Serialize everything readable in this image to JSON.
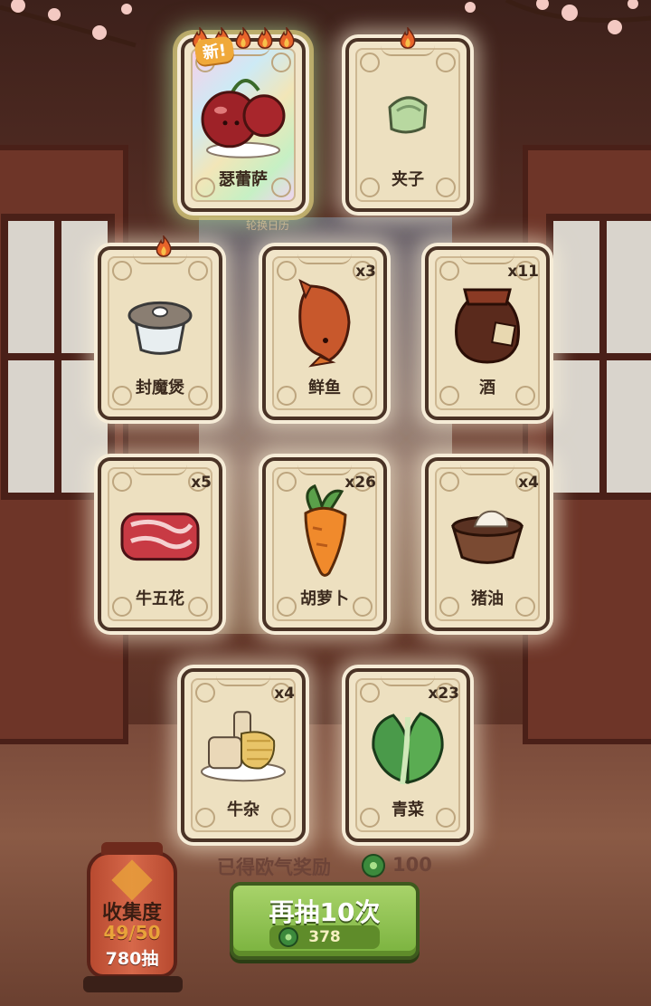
{
  "hint_text": "轮换日历",
  "cards": [
    {
      "id": "c1",
      "name": "瑟蕾萨",
      "count": "",
      "flames": 5,
      "new": true,
      "new_label": "新!",
      "art": "cherry-icon"
    },
    {
      "id": "c2",
      "name": "夹子",
      "count": "",
      "flames": 1,
      "new": false,
      "art": "clip-icon"
    },
    {
      "id": "c3",
      "name": "封魔煲",
      "count": "",
      "flames": 1,
      "new": false,
      "art": "pot-icon"
    },
    {
      "id": "c4",
      "name": "鲜鱼",
      "count": "x3",
      "flames": 0,
      "new": false,
      "art": "fish-icon"
    },
    {
      "id": "c5",
      "name": "酒",
      "count": "x11",
      "flames": 0,
      "new": false,
      "art": "wine-jar-icon"
    },
    {
      "id": "c6",
      "name": "牛五花",
      "count": "x5",
      "flames": 0,
      "new": false,
      "art": "beef-icon"
    },
    {
      "id": "c7",
      "name": "胡萝卜",
      "count": "x26",
      "flames": 0,
      "new": false,
      "art": "carrot-icon"
    },
    {
      "id": "c8",
      "name": "猪油",
      "count": "x4",
      "flames": 0,
      "new": false,
      "art": "lard-icon"
    },
    {
      "id": "c9",
      "name": "牛杂",
      "count": "x4",
      "flames": 0,
      "new": false,
      "art": "offal-icon"
    },
    {
      "id": "c10",
      "name": "青菜",
      "count": "x23",
      "flames": 0,
      "new": false,
      "art": "greens-icon"
    }
  ],
  "reward": {
    "label": "已得欧气奖励",
    "value": "100",
    "icon": "jade-coin-icon"
  },
  "draw_button": {
    "label": "再抽10次",
    "cost": "378",
    "icon": "jade-coin-icon"
  },
  "collection": {
    "title": "收集度",
    "progress": "49/50",
    "draws": "780抽"
  },
  "colors": {
    "card_bg": "#f1e5c9",
    "button_green": "#7ab23e",
    "flame": "#e8642a"
  }
}
